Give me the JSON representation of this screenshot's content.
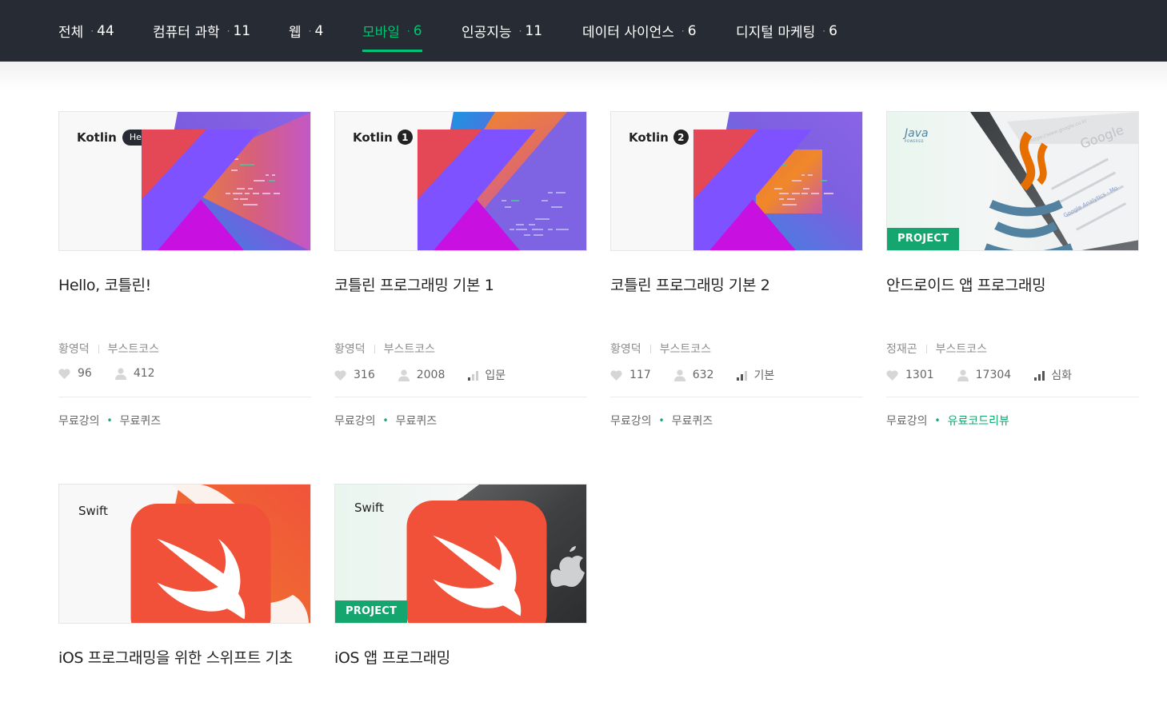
{
  "nav": {
    "tabs": [
      {
        "label": "전체",
        "count": "44"
      },
      {
        "label": "컴퓨터 과학",
        "count": "11"
      },
      {
        "label": "웹",
        "count": "4"
      },
      {
        "label": "모바일",
        "count": "6"
      },
      {
        "label": "인공지능",
        "count": "11"
      },
      {
        "label": "데이터 사이언스",
        "count": "6"
      },
      {
        "label": "디지털 마케팅",
        "count": "6"
      }
    ],
    "active_tab": "모바일",
    "accent_color": "#00c473"
  },
  "courses": [
    {
      "title": "Hello, 코틀린!",
      "thumb": {
        "logo_text": "Kotlin",
        "tag_text": "Hello",
        "logo_icon": "kotlin-icon"
      },
      "instructor": "황영덕",
      "provider": "부스트코스",
      "likes": "96",
      "students": "412",
      "level": "",
      "tags": [
        "무료강의",
        "무료퀴즈"
      ]
    },
    {
      "title": "코틀린 프로그래밍 기본 1",
      "thumb": {
        "logo_text": "Kotlin",
        "tag_text": "1",
        "logo_icon": "kotlin-icon"
      },
      "instructor": "황영덕",
      "provider": "부스트코스",
      "likes": "316",
      "students": "2008",
      "level": "입문",
      "tags": [
        "무료강의",
        "무료퀴즈"
      ]
    },
    {
      "title": "코틀린 프로그래밍 기본 2",
      "thumb": {
        "logo_text": "Kotlin",
        "tag_text": "2",
        "logo_icon": "kotlin-icon"
      },
      "instructor": "황영덕",
      "provider": "부스트코스",
      "likes": "117",
      "students": "632",
      "level": "기본",
      "tags": [
        "무료강의",
        "무료퀴즈"
      ]
    },
    {
      "title": "안드로이드 앱 프로그래밍",
      "thumb": {
        "logo_text": "Java",
        "logo_sub": "POWERED",
        "logo_icon": "java-icon",
        "badge": "PROJECT",
        "screen_brand": "Google",
        "screen_url": "https://www.google.co.kr",
        "screen_result": "Google Analytics · Mo"
      },
      "instructor": "정재곤",
      "provider": "부스트코스",
      "likes": "1301",
      "students": "17304",
      "level": "심화",
      "tags": [
        "무료강의",
        "유료코드리뷰"
      ]
    },
    {
      "title": "iOS 프로그래밍을 위한 스위프트 기초",
      "thumb": {
        "logo_text": "Swift",
        "logo_icon": "swift-icon"
      },
      "instructor": "",
      "provider": "",
      "likes": "",
      "students": "",
      "level": "",
      "tags": []
    },
    {
      "title": "iOS 앱 프로그래밍",
      "thumb": {
        "logo_text": "Swift",
        "logo_icon": "swift-icon",
        "badge": "PROJECT"
      },
      "instructor": "",
      "provider": "",
      "likes": "",
      "students": "",
      "level": "",
      "tags": []
    }
  ],
  "icons": {
    "like": "heart-icon",
    "students": "person-icon",
    "level": "level-bars-icon"
  }
}
